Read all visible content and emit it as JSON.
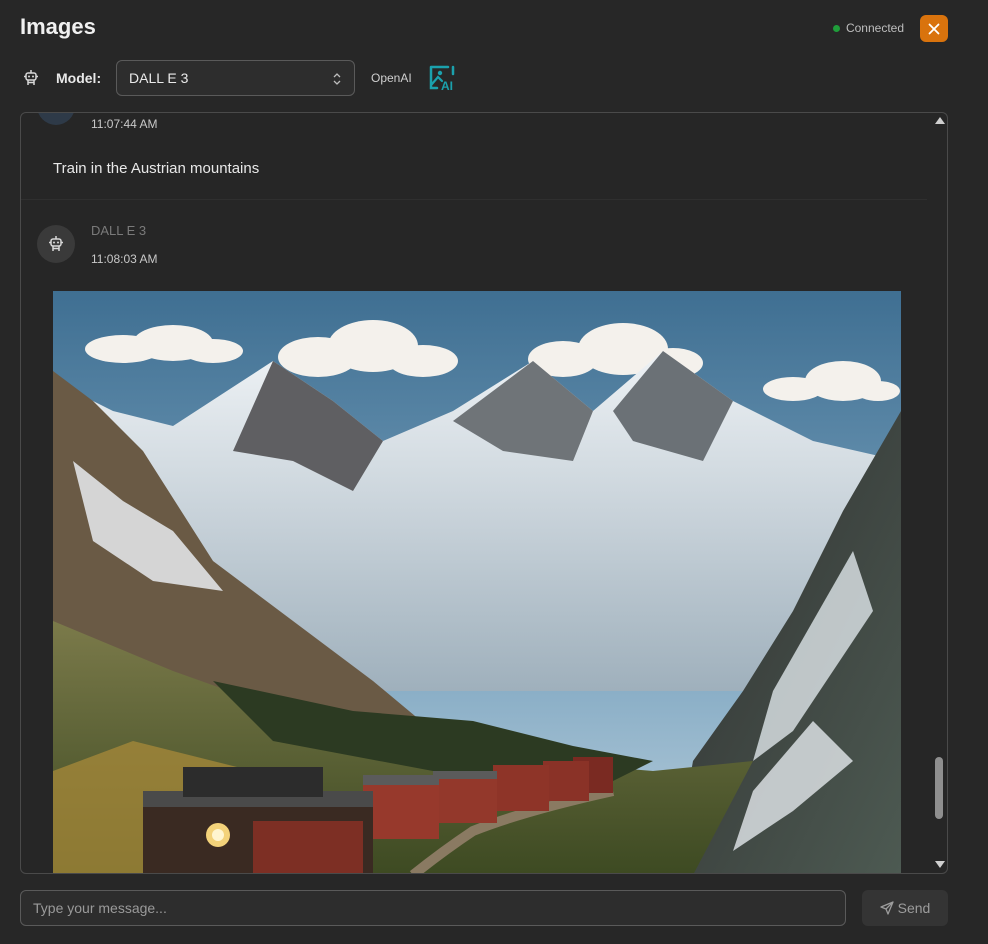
{
  "header": {
    "title": "Images",
    "status_label": "Connected",
    "status_color": "#1f9d3a",
    "close_icon": "close-icon",
    "close_color": "#d9730d"
  },
  "model_bar": {
    "icon": "robot-icon",
    "label": "Model:",
    "selected": "DALL E 3",
    "provider": "OpenAI",
    "provider_icon": "image-ai-icon"
  },
  "messages": [
    {
      "role": "user",
      "time": "11:07:44 AM",
      "text": "Train in the Austrian mountains"
    },
    {
      "role": "assistant",
      "name": "DALL E 3",
      "time": "11:08:03 AM",
      "image_icon": "generated-image"
    }
  ],
  "composer": {
    "placeholder": "Type your message...",
    "send_label": "Send",
    "send_icon": "send-icon"
  }
}
